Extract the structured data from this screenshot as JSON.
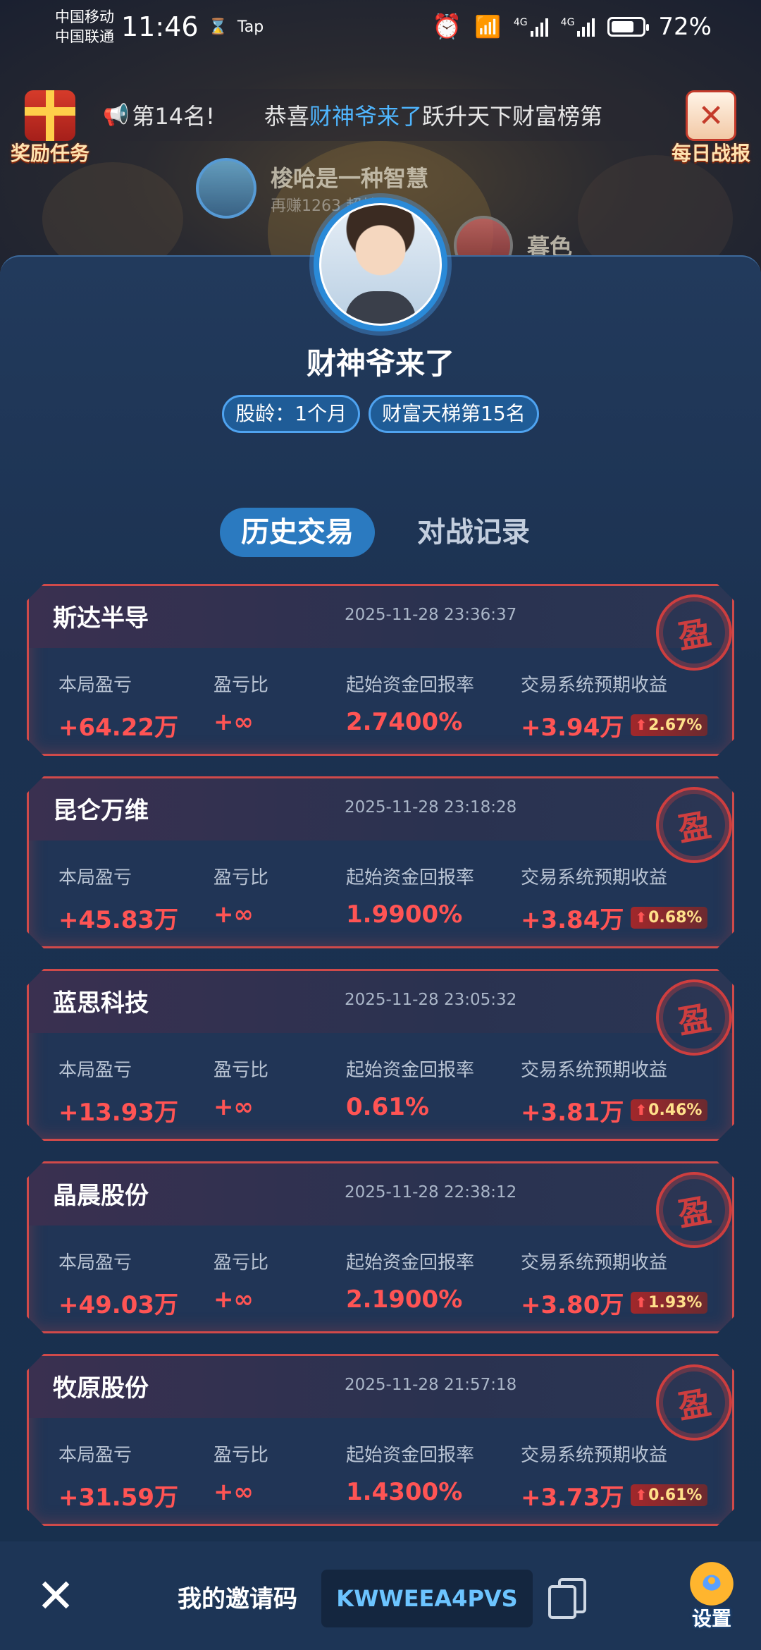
{
  "status_bar": {
    "carrier1": "中国移动",
    "carrier2": "中国联通",
    "time": "11:46",
    "hourglass": "⌛",
    "tap": "Tap",
    "net1": "4G",
    "net2": "4G",
    "battery": "72%",
    "battery_level": 0.72
  },
  "banner": {
    "left_button": "奖励任务",
    "right_button": "每日战报",
    "marquee_prefix": "第14名!",
    "marquee_lead": "恭喜",
    "marquee_name": "财神爷来了",
    "marquee_rest": "跃升天下财富榜第",
    "bg_user1_name": "梭哈是一种智慧",
    "bg_user1_sub": "再赚1263",
    "bg_user1_sub2": "超越TA",
    "bg_user2_name": "暮色"
  },
  "profile": {
    "name": "财神爷来了",
    "badge_age": "股龄：1个月",
    "badge_rank": "财富天梯第15名"
  },
  "tabs": [
    {
      "label": "历史交易",
      "active": true
    },
    {
      "label": "对战记录",
      "active": false
    }
  ],
  "card_labels": {
    "pnl": "本局盈亏",
    "ratio": "盈亏比",
    "return": "起始资金回报率",
    "expected": "交易系统预期收益",
    "stamp": "盈"
  },
  "trades": [
    {
      "name": "斯达半导",
      "time": "2025-11-28 23:36:37",
      "pnl": "+64.22万",
      "ratio": "+∞",
      "return": "2.7400%",
      "expected": "+3.94万",
      "pct": "2.67%"
    },
    {
      "name": "昆仑万维",
      "time": "2025-11-28 23:18:28",
      "pnl": "+45.83万",
      "ratio": "+∞",
      "return": "1.9900%",
      "expected": "+3.84万",
      "pct": "0.68%"
    },
    {
      "name": "蓝思科技",
      "time": "2025-11-28 23:05:32",
      "pnl": "+13.93万",
      "ratio": "+∞",
      "return": "0.61%",
      "expected": "+3.81万",
      "pct": "0.46%"
    },
    {
      "name": "晶晨股份",
      "time": "2025-11-28 22:38:12",
      "pnl": "+49.03万",
      "ratio": "+∞",
      "return": "2.1900%",
      "expected": "+3.80万",
      "pct": "1.93%"
    },
    {
      "name": "牧原股份",
      "time": "2025-11-28 21:57:18",
      "pnl": "+31.59万",
      "ratio": "+∞",
      "return": "1.4300%",
      "expected": "+3.73万",
      "pct": "0.61%"
    }
  ],
  "bottom": {
    "close": "✕",
    "invite_label": "我的邀请码",
    "invite_code": "KWWEEA4PVS",
    "settings_label": "设置"
  },
  "colors": {
    "accent_blue": "#2b7ac0",
    "profit_red": "#ff5454",
    "card_border": "#d04a4a",
    "panel_bg": "#1b3150"
  }
}
